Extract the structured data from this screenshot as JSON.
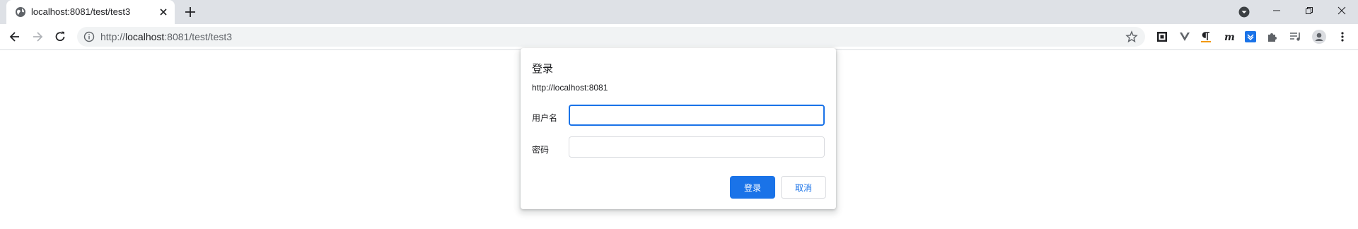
{
  "tab": {
    "title": "localhost:8081/test/test3"
  },
  "omnibox": {
    "scheme": "http://",
    "host": "localhost",
    "rest": ":8081/test/test3"
  },
  "dialog": {
    "title": "登录",
    "origin": "http://localhost:8081",
    "username_label": "用户名",
    "username_value": "",
    "password_label": "密码",
    "password_value": "",
    "login_button": "登录",
    "cancel_button": "取消"
  },
  "colors": {
    "accent": "#1a73e8",
    "tabstrip": "#dee1e6",
    "omnibox_bg": "#f1f3f4"
  },
  "icons": {
    "extensions": [
      "qr-icon",
      "vue-devtools-icon",
      "paragraph-icon",
      "m-icon",
      "download-icon",
      "puzzle-icon",
      "media-icon",
      "avatar-icon",
      "menu-icon"
    ]
  }
}
